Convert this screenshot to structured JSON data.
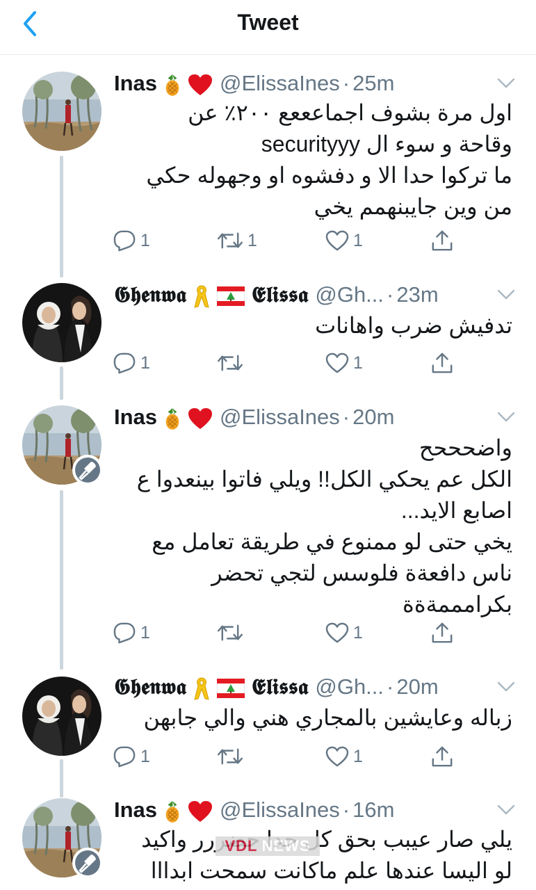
{
  "header": {
    "title": "Tweet"
  },
  "tweets": [
    {
      "name": "Inas",
      "handle": "@ElissaInes",
      "sep": "·",
      "time": "25m",
      "lines": [
        "اول مرة بشوف اجماعععع ٢٠٠٪ عن",
        "وقاحة و سوء ال securityyy",
        "ما تركوا حدا الا و دفشوه او وجهوله حكي",
        "من وين جايبنهمم يخي"
      ],
      "reply_count": "1",
      "retweet_count": "1",
      "like_count": "1"
    },
    {
      "name": "𝕲𝖍𝖊𝖓𝖜𝖆",
      "name2": "𝕰𝖑𝖎𝖘𝖘𝖆",
      "handle": "@Gh...",
      "sep": "·",
      "time": "23m",
      "lines": [
        "تدفيش ضرب واهانات"
      ],
      "reply_count": "1",
      "retweet_count": "",
      "like_count": "1"
    },
    {
      "name": "Inas",
      "handle": "@ElissaInes",
      "sep": "·",
      "time": "20m",
      "lines": [
        "واضحححح",
        "الكل عم يحكي الكل!! ويلي فاتوا بينعدوا ع",
        "اصابع الايد...",
        "يخي حتى لو ممنوع في طريقة تعامل مع",
        "ناس دافعةة فلوسس لتجي تحضر",
        "بكرامممةةة"
      ],
      "reply_count": "1",
      "retweet_count": "",
      "like_count": "1"
    },
    {
      "name": "𝕲𝖍𝖊𝖓𝖜𝖆",
      "name2": "𝕰𝖑𝖎𝖘𝖘𝖆",
      "handle": "@Gh...",
      "sep": "·",
      "time": "20m",
      "lines": [
        "زباله وعايشين بالمجاري هني والي جابهن"
      ],
      "reply_count": "1",
      "retweet_count": "",
      "like_count": "1"
    },
    {
      "name": "Inas",
      "handle": "@ElissaInes",
      "sep": "·",
      "time": "16m",
      "lines": [
        "يلي صار عيبب بحق كل حدا حضررر واكيد",
        "لو اليسا عندها علم ماكانت سمحت ابدااا"
      ],
      "reply_count": "",
      "retweet_count": "",
      "like_count": ""
    }
  ],
  "watermark": {
    "part1": "VDL",
    "part2": "NEWS"
  },
  "colors": {
    "accent": "#1da1f2",
    "muted": "#657786",
    "thread": "#ccd6dd",
    "heart": "#e0245e"
  },
  "icons": [
    "back-chevron-icon",
    "pineapple-emoji-icon",
    "red-heart-emoji-icon",
    "yellow-ribbon-emoji-icon",
    "lebanon-flag-emoji-icon",
    "reply-icon",
    "retweet-icon",
    "like-icon",
    "share-icon",
    "caret-down-icon",
    "mic-icon"
  ]
}
